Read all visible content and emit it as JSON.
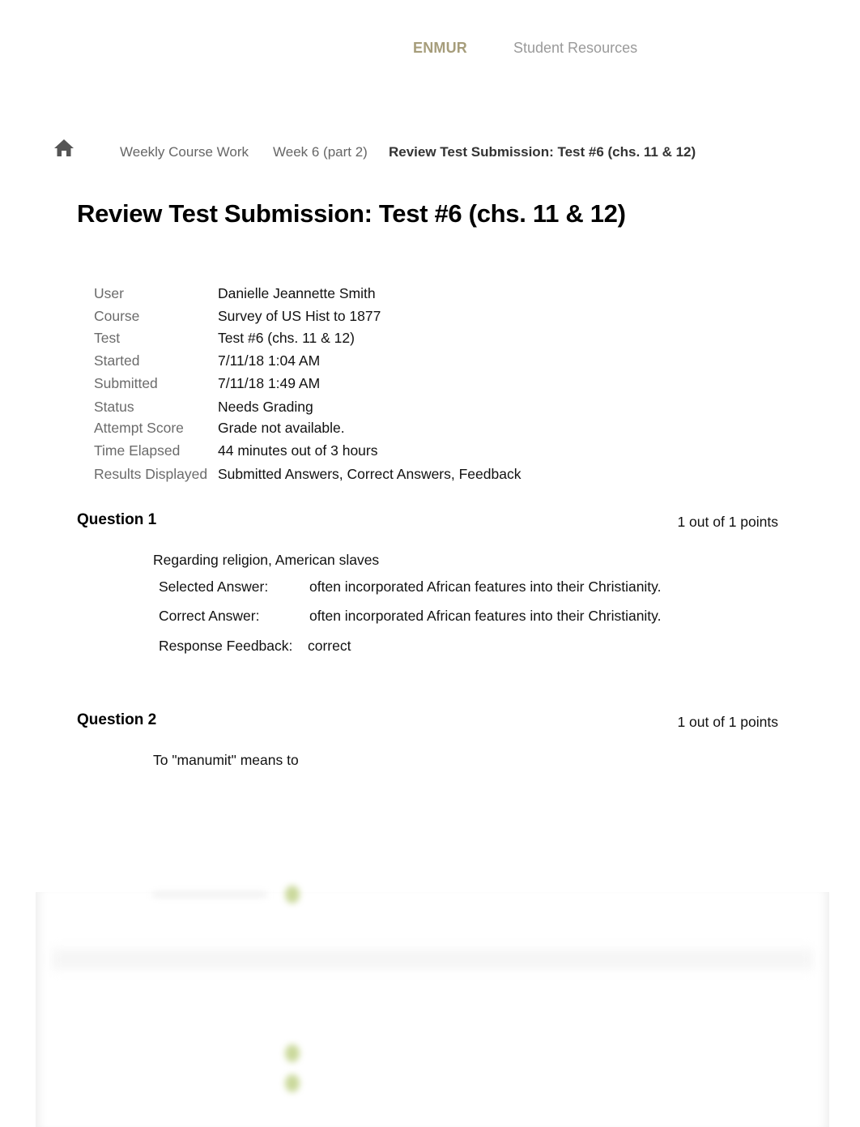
{
  "topnav": {
    "brand": "ENMUR",
    "resources_link": "Student Resources",
    "brand_color": "#a69d7b"
  },
  "breadcrumb": {
    "home_icon": "home-icon",
    "items": [
      "Weekly Course Work",
      "Week 6 (part 2)"
    ],
    "current": "Review Test Submission: Test #6 (chs. 11 & 12)"
  },
  "page": {
    "title": "Review Test Submission: Test #6 (chs. 11 & 12)"
  },
  "details": [
    {
      "label": "User",
      "value": "Danielle Jeannette Smith"
    },
    {
      "label": "Course",
      "value": "Survey of US Hist to 1877"
    },
    {
      "label": "Test",
      "value": "Test #6 (chs. 11 & 12)"
    },
    {
      "label": "Started",
      "value": "7/11/18 1:04 AM"
    },
    {
      "label": "Submitted",
      "value": "7/11/18 1:49 AM"
    },
    {
      "label": "Status",
      "value": "Needs Grading"
    },
    {
      "label": "Attempt Score",
      "value": "Grade not available."
    },
    {
      "label": "Time Elapsed",
      "value": "44 minutes out of 3 hours"
    },
    {
      "label": "Results Displayed",
      "value": "Submitted Answers, Correct Answers, Feedback"
    }
  ],
  "questions": [
    {
      "title": "Question 1",
      "points": "1 out of 1 points",
      "text": "Regarding religion, American slaves",
      "selected_label": "Selected Answer:",
      "selected_answer": "often incorporated African features into their Christianity.",
      "correct_label": "Correct Answer:",
      "correct_answer": "often incorporated African features into their Christianity.",
      "feedback_label": "Response Feedback:",
      "feedback": "correct"
    },
    {
      "title": "Question 2",
      "points": "1 out of 1 points",
      "text": "To \"manumit\" means to"
    }
  ]
}
